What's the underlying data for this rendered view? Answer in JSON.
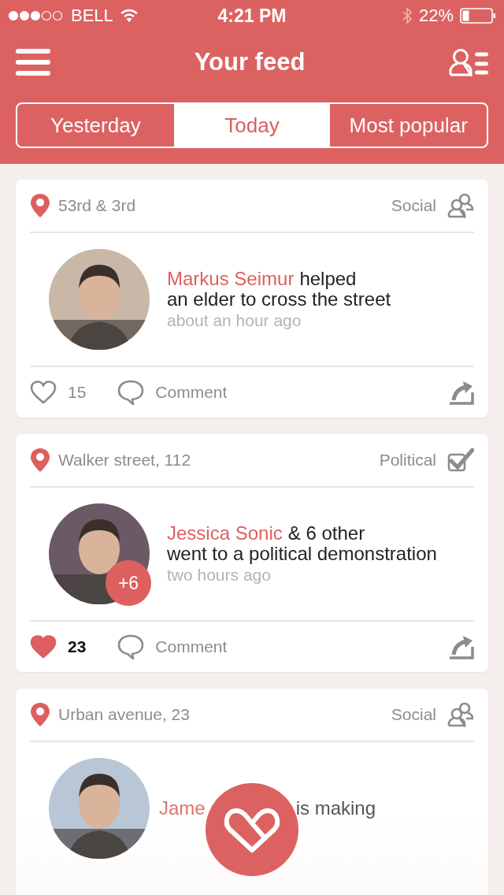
{
  "status_bar": {
    "carrier": "BELL",
    "time": "4:21 PM",
    "battery": "22%"
  },
  "header": {
    "title": "Your feed"
  },
  "tabs": [
    {
      "label": "Yesterday",
      "selected": false
    },
    {
      "label": "Today",
      "selected": true
    },
    {
      "label": "Most popular",
      "selected": false
    }
  ],
  "cards": [
    {
      "location": "53rd & 3rd",
      "category": "Social",
      "kind": "social",
      "name": "Markus Seimur",
      "action": [
        "helped",
        "an elder to cross the street"
      ],
      "time": "about an hour ago",
      "likes": "15",
      "liked": false,
      "comment": "Comment"
    },
    {
      "location": "Walker street, 112",
      "category": "Political",
      "kind": "political",
      "name": "Jessica Sonic",
      "action": [
        "& 6 other",
        "went to a political demonstration"
      ],
      "time": "two hours ago",
      "badge": "+6",
      "likes": "23",
      "liked": true,
      "comment": "Comment"
    },
    {
      "location": "Urban avenue, 23",
      "category": "Social",
      "kind": "social",
      "name": "Jame",
      "action": [
        "is making"
      ]
    }
  ]
}
